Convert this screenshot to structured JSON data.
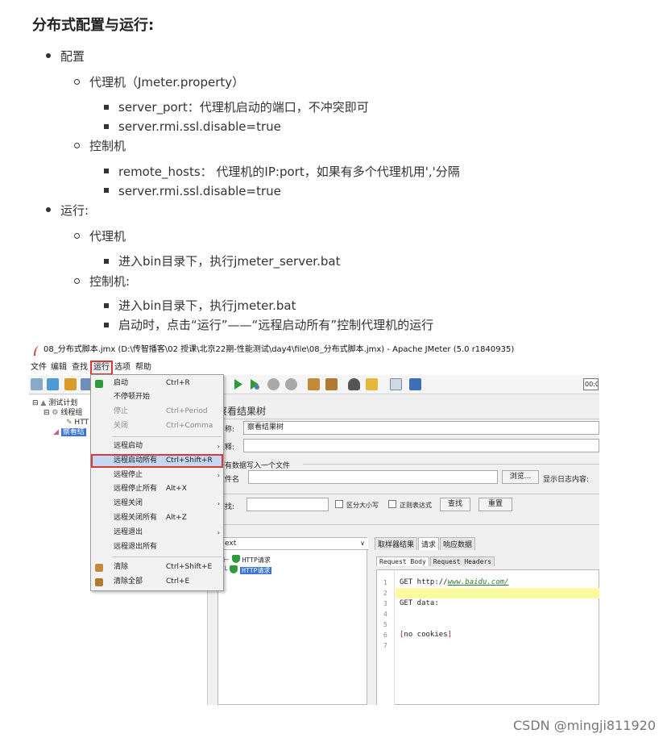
{
  "article": {
    "heading": "分布式配置与运行:",
    "items": [
      "配置",
      "代理机（Jmeter.property）",
      "server_port：代理机启动的端口，不冲突即可",
      "server.rmi.ssl.disable=true",
      "控制机",
      "remote_hosts： 代理机的IP:port，如果有多个代理机用','分隔",
      "server.rmi.ssl.disable=true",
      "运行:",
      "代理机",
      "进入bin目录下，执行jmeter_server.bat",
      "控制机:",
      "进入bin目录下，执行jmeter.bat",
      "启动时，点击“运行”——“远程启动所有”控制代理机的运行"
    ]
  },
  "screenshot": {
    "window_title": "08_分布式脚本.jmx (D:\\传智播客\\02 授课\\北京22期-性能测试\\day4\\file\\08_分布式脚本.jmx) - Apache JMeter (5.0 r1840935)",
    "menus": [
      "文件",
      "编辑",
      "查找",
      "运行",
      "选项",
      "帮助"
    ],
    "toolbar_time": "00:0",
    "tree": {
      "test_plan": "测试计划",
      "thread_group": "线程组",
      "http": "HTT",
      "result_tree": "察看结"
    },
    "panel": {
      "title": "察看结果树",
      "name_label": "名称:",
      "name_value": "察看结果树",
      "comment_label": "注释:",
      "write_all": "所有数据写入一个文件",
      "file_label": "文件名",
      "browse": "浏览...",
      "log_label": "显示日志内容:",
      "search_label": "查找:",
      "case_label": "区分大小写",
      "regex_label": "正则表达式",
      "find_btn": "查找",
      "reset_btn": "重置",
      "renderer": "ext",
      "samples": [
        "HTTP请求",
        "HTTP请求"
      ],
      "result_tabs": [
        "取样器结果",
        "请求",
        "响应数据"
      ],
      "sub_tabs": [
        "Request Body",
        "Request Headers"
      ],
      "code_lines": [
        "1",
        "2",
        "3",
        "4",
        "5",
        "6",
        "7"
      ],
      "code_get_prefix": "GET http://",
      "code_get_url": "www.baidu.com/",
      "code_get_data": "GET data:",
      "code_cookie_open": "[",
      "code_cookie_text": "no cookies",
      "code_cookie_close": "]"
    },
    "run_menu": [
      {
        "label": "启动",
        "shortcut": "Ctrl+R"
      },
      {
        "label": "不停顿开始",
        "shortcut": ""
      },
      {
        "label": "停止",
        "shortcut": "Ctrl+Period"
      },
      {
        "label": "关闭",
        "shortcut": "Ctrl+Comma"
      },
      {
        "label": "远程启动",
        "shortcut": ""
      },
      {
        "label": "远程启动所有",
        "shortcut": "Ctrl+Shift+R"
      },
      {
        "label": "远程停止",
        "shortcut": ""
      },
      {
        "label": "远程停止所有",
        "shortcut": "Alt+X"
      },
      {
        "label": "远程关闭",
        "shortcut": ""
      },
      {
        "label": "远程关闭所有",
        "shortcut": "Alt+Z"
      },
      {
        "label": "远程退出",
        "shortcut": ""
      },
      {
        "label": "远程退出所有",
        "shortcut": ""
      },
      {
        "label": "清除",
        "shortcut": "Ctrl+Shift+E"
      },
      {
        "label": "清除全部",
        "shortcut": "Ctrl+E"
      }
    ],
    "colors": {
      "highlight_border": "#d83a3a",
      "selection": "#3875d7",
      "run_green": "#2e9a3c"
    }
  },
  "watermark": "CSDN @mingji811920"
}
